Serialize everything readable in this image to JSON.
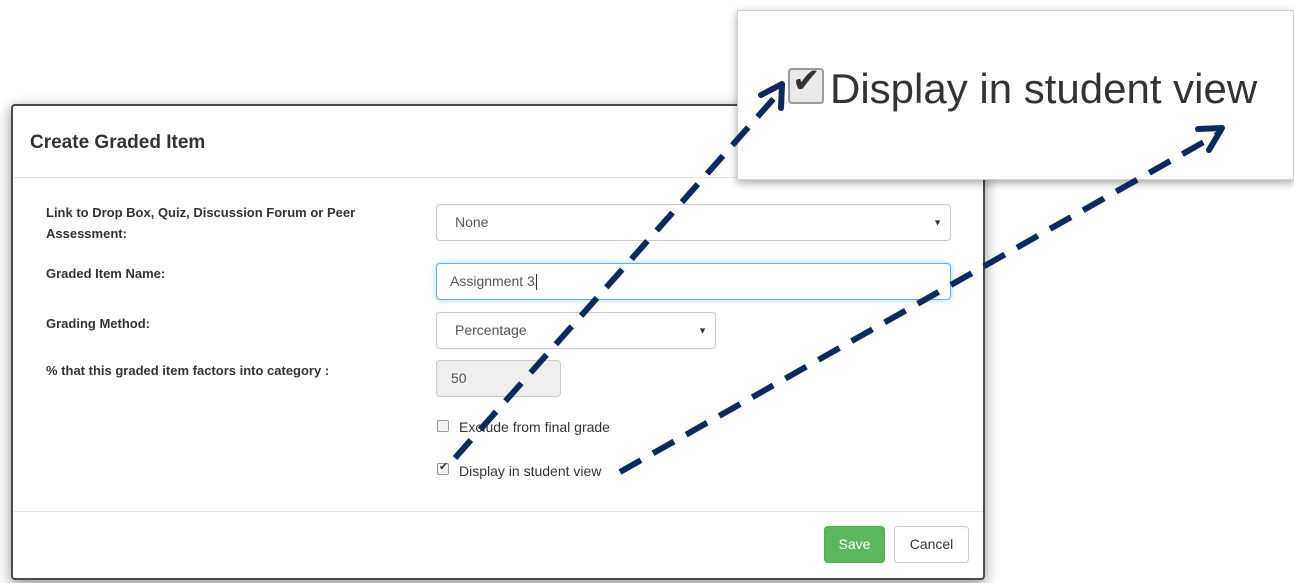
{
  "modal": {
    "title": "Create Graded Item",
    "link_label_line1": "Link to Drop Box, Quiz, Discussion Forum or Peer",
    "link_label_line2": "Assessment:",
    "link_value": "None",
    "name_label": "Graded Item Name:",
    "name_value": "Assignment 3",
    "method_label": "Grading Method:",
    "method_value": "Percentage",
    "factor_label": "% that this graded item factors into category :",
    "factor_value": "50",
    "exclude_label": "Exclude from final grade",
    "exclude_checked": false,
    "display_label": "Display in student view",
    "display_checked": true,
    "save_label": "Save",
    "cancel_label": "Cancel"
  },
  "zoom": {
    "label": "Display in student view",
    "checked": true
  },
  "icons": {
    "check": "checkmark-icon",
    "caret": "caret-down-icon",
    "arrow": "dashed-arrow"
  },
  "colors": {
    "save": "#5cb85c",
    "focus": "#66afe9",
    "arrow": "#0d2a5c"
  }
}
